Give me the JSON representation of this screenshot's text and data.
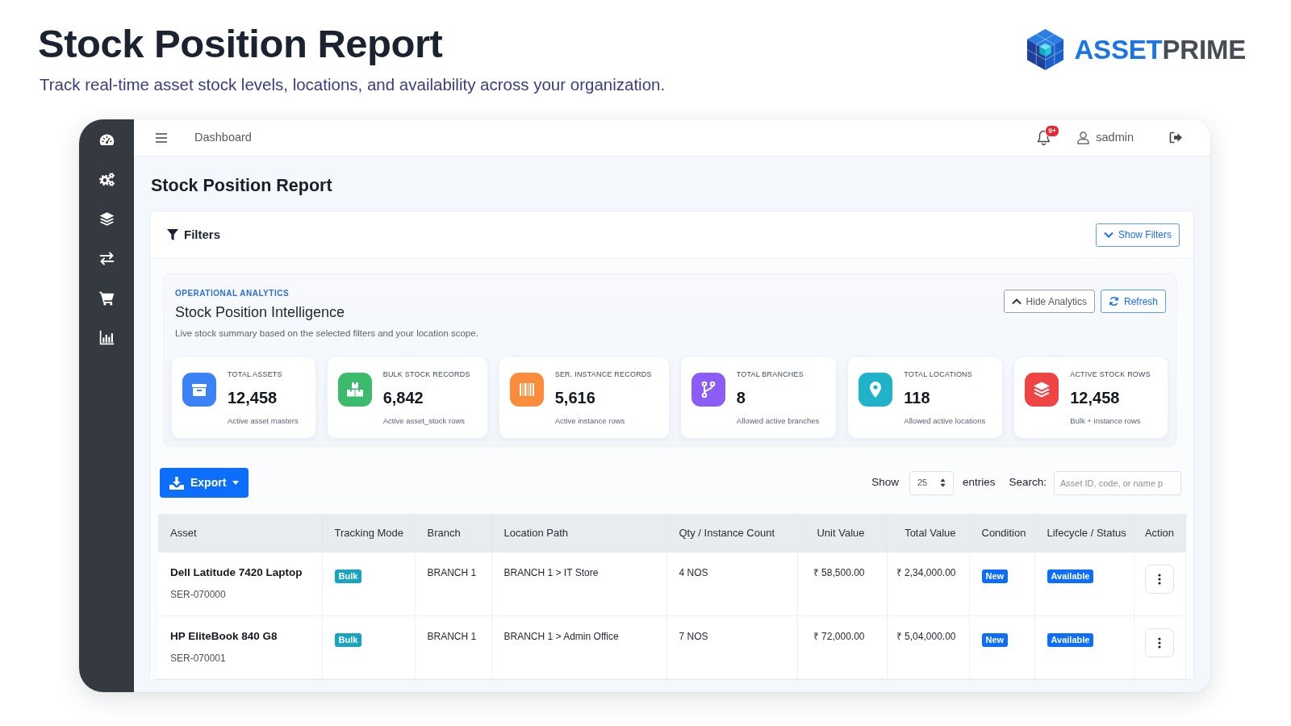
{
  "header": {
    "title": "Stock Position Report",
    "subtitle": "Track real-time asset stock levels, locations, and availability across your organization.",
    "logo": {
      "wordmark": [
        "ASSET",
        "PRIME"
      ]
    }
  },
  "sidebar": {
    "items": [
      {
        "kind": "dashboard"
      },
      {
        "kind": "settings"
      },
      {
        "kind": "layers"
      },
      {
        "kind": "transfer"
      },
      {
        "kind": "cart"
      },
      {
        "kind": "reports"
      }
    ]
  },
  "topbar": {
    "breadcrumb": "Dashboard",
    "notification_count": "9+",
    "user": "sadmin"
  },
  "page_title": "Stock Position Report",
  "filters": {
    "title": "Filters",
    "toggle_button": "Show Filters"
  },
  "analytics": {
    "eyebrow": "OPERATIONAL ANALYTICS",
    "title": "Stock Position Intelligence",
    "description": "Live stock summary based on the selected filters and your location scope.",
    "buttons": [
      {
        "kind": "collapse",
        "label": "Hide Analytics"
      },
      {
        "kind": "refresh",
        "label": "Refresh"
      }
    ],
    "stats": [
      {
        "kind": "box",
        "color": "#3b82f6",
        "label": "TOTAL ASSETS",
        "value": "12,458",
        "note": "Active asset masters"
      },
      {
        "kind": "boxes",
        "color": "#3dbb6c",
        "label": "BULK STOCK RECORDS",
        "value": "6,842",
        "note": "Active asset_stock rows"
      },
      {
        "kind": "barcode",
        "color": "#fb8c3c",
        "label": "SER. INSTANCE RECORDS",
        "value": "5,616",
        "note": "Active instance rows"
      },
      {
        "kind": "branch",
        "color": "#8b5cf6",
        "label": "TOTAL BRANCHES",
        "value": "8",
        "note": "Allowed active branches"
      },
      {
        "kind": "pin",
        "color": "#1fb2c9",
        "label": "TOTAL LOCATIONS",
        "value": "118",
        "note": "Allowed active locations"
      },
      {
        "kind": "layers",
        "color": "#ef4444",
        "label": "ACTIVE STOCK ROWS",
        "value": "12,458",
        "note": "Bulk + instance rows"
      }
    ]
  },
  "table_controls": {
    "export_button": "Export",
    "show_label": "Show",
    "page_size": "25",
    "entries_label": "entries",
    "search_label": "Search:",
    "search_placeholder": "Asset ID, code, or name p"
  },
  "table": {
    "columns": [
      "Asset",
      "Tracking Mode",
      "Branch",
      "Location Path",
      "Qty / Instance Count",
      "Unit Value",
      "Total Value",
      "Condition",
      "Lifecycle / Status",
      "Action"
    ],
    "rows": [
      {
        "asset": "Dell Latitude 7420 Laptop",
        "code": "SER-070000",
        "tracking_mode": "Bulk",
        "branch": "BRANCH 1",
        "location_path": "BRANCH 1 > IT Store",
        "quantity": "4 NOS",
        "unit_value": "₹ 58,500.00",
        "total_value": "₹ 2,34,000.00",
        "condition": "New",
        "status": "Available"
      },
      {
        "asset": "HP EliteBook 840 G8",
        "code": "SER-070001",
        "tracking_mode": "Bulk",
        "branch": "BRANCH 1",
        "location_path": "BRANCH 1 > Admin Office",
        "quantity": "7 NOS",
        "unit_value": "₹ 72,000.00",
        "total_value": "₹ 5,04,000.00",
        "condition": "New",
        "status": "Available"
      }
    ]
  }
}
